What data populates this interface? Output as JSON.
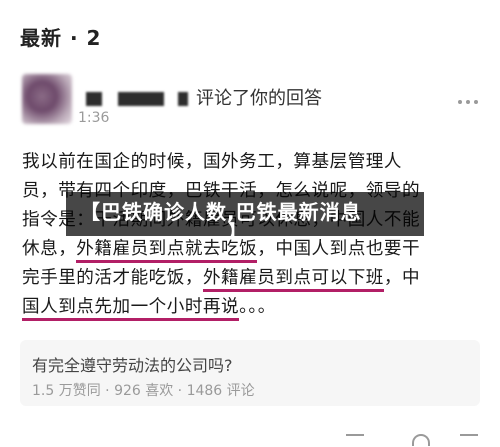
{
  "section": {
    "title": "最新 · 2"
  },
  "comment": {
    "action_text": "评论了你的回答",
    "time_text": "1:36"
  },
  "answer": {
    "lines": [
      [
        "我以前在国企的时候，国外务工，算基层管理人"
      ],
      [
        "员，带有四个印度，巴铁干活，怎么说呢，领导的"
      ],
      [
        "指令是：干活期间外籍雇员可以休息，中国人不能"
      ],
      [
        "休息，",
        {
          "hl": "外籍雇员到点就去吃饭"
        },
        "，中国人到点也要干"
      ],
      [
        "完手里的活才能吃饭，",
        {
          "hl": "外籍雇员到点可以下班"
        },
        "，中"
      ],
      [
        {
          "hl": "国人到点先加一个小时再说"
        },
        "。。。"
      ]
    ]
  },
  "overlay": {
    "title": "【巴铁确诊人数,巴铁最新消息",
    "suffix": "】"
  },
  "quote": {
    "question": "有完全遵守劳动法的公司吗?",
    "stats": "1.5 万赞同 · 926 喜欢 · 1486 评论"
  },
  "colors": {
    "highlight": "#b21f66",
    "muted": "#9a9a9a",
    "card_bg": "#f6f6f6"
  }
}
